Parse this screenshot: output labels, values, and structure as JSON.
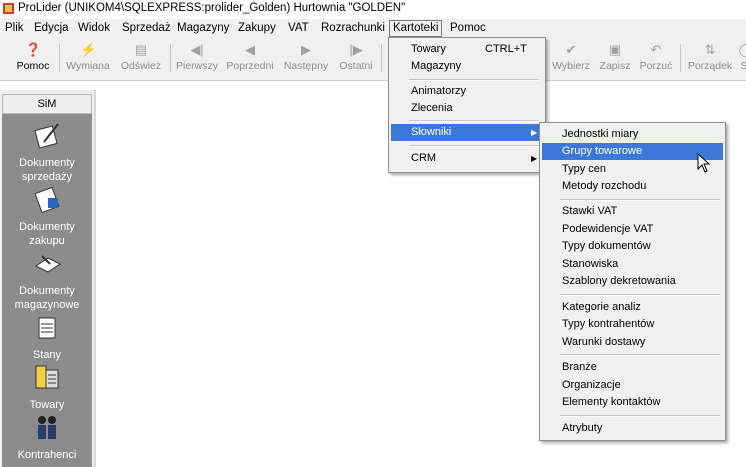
{
  "window": {
    "title": "ProLider  (UNIKOM4\\SQLEXPRESS:prolider_Golden) Hurtownia \"GOLDEN\""
  },
  "menubar": {
    "items": [
      "Plik",
      "Edycja",
      "Widok",
      "Sprzedaż",
      "Magazyny",
      "Zakupy",
      "VAT",
      "Rozrachunki",
      "Kartoteki",
      "Pomoc"
    ],
    "open_item": "Kartoteki"
  },
  "toolbar": {
    "buttons": [
      {
        "label": "Pomoc",
        "icon": "help-icon",
        "enabled": true
      },
      {
        "label": "Wymiana",
        "icon": "exchange-icon",
        "enabled": false
      },
      {
        "label": "Odśwież",
        "icon": "refresh-icon",
        "enabled": false
      },
      {
        "label": "Pierwszy",
        "icon": "first-icon",
        "enabled": false
      },
      {
        "label": "Poprzedni",
        "icon": "previous-icon",
        "enabled": false
      },
      {
        "label": "Następny",
        "icon": "next-icon",
        "enabled": false
      },
      {
        "label": "Ostatni",
        "icon": "last-icon",
        "enabled": false
      },
      {
        "label": "Wybierz",
        "icon": "select-icon",
        "enabled": false
      },
      {
        "label": "Zapisz",
        "icon": "save-icon",
        "enabled": false
      },
      {
        "label": "Porzuć",
        "icon": "undo-icon",
        "enabled": false
      },
      {
        "label": "Porządek",
        "icon": "sort-icon",
        "enabled": false
      },
      {
        "label": "S",
        "icon": "search-icon",
        "enabled": false
      }
    ]
  },
  "sidebar": {
    "header": "SiM",
    "items": [
      {
        "label": "Dokumenty sprzedaży",
        "icon": "sales-documents-icon"
      },
      {
        "label": "Dokumenty zakupu",
        "icon": "purchase-documents-icon"
      },
      {
        "label": "Dokumenty magazynowe",
        "icon": "warehouse-documents-icon"
      },
      {
        "label": "Stany",
        "icon": "stock-levels-icon"
      },
      {
        "label": "Towary",
        "icon": "goods-icon"
      },
      {
        "label": "Kontrahenci",
        "icon": "contractors-icon"
      }
    ]
  },
  "kartoteki_menu": {
    "items": [
      {
        "label": "Towary",
        "shortcut": "CTRL+T"
      },
      {
        "label": "Magazyny",
        "shortcut": ""
      },
      {
        "label": "Animatorzy",
        "shortcut": ""
      },
      {
        "label": "Zlecenia",
        "shortcut": ""
      },
      {
        "label": "Słowniki",
        "shortcut": "",
        "submenu": true,
        "highlighted": true
      },
      {
        "label": "CRM",
        "shortcut": "",
        "submenu": true
      }
    ]
  },
  "slowniki_submenu": {
    "items": [
      "Jednostki miary",
      "Grupy towarowe",
      "Typy cen",
      "Metody rozchodu",
      "Stawki VAT",
      "Podewidencje VAT",
      "Typy dokumentów",
      "Stanowiska",
      "Szablony dekretowania",
      "Kategorie analiz",
      "Typy kontrahentów",
      "Warunki dostawy",
      "Branże",
      "Organizacje",
      "Elementy kontaktów",
      "Atrybuty"
    ],
    "highlighted": "Grupy towarowe"
  }
}
